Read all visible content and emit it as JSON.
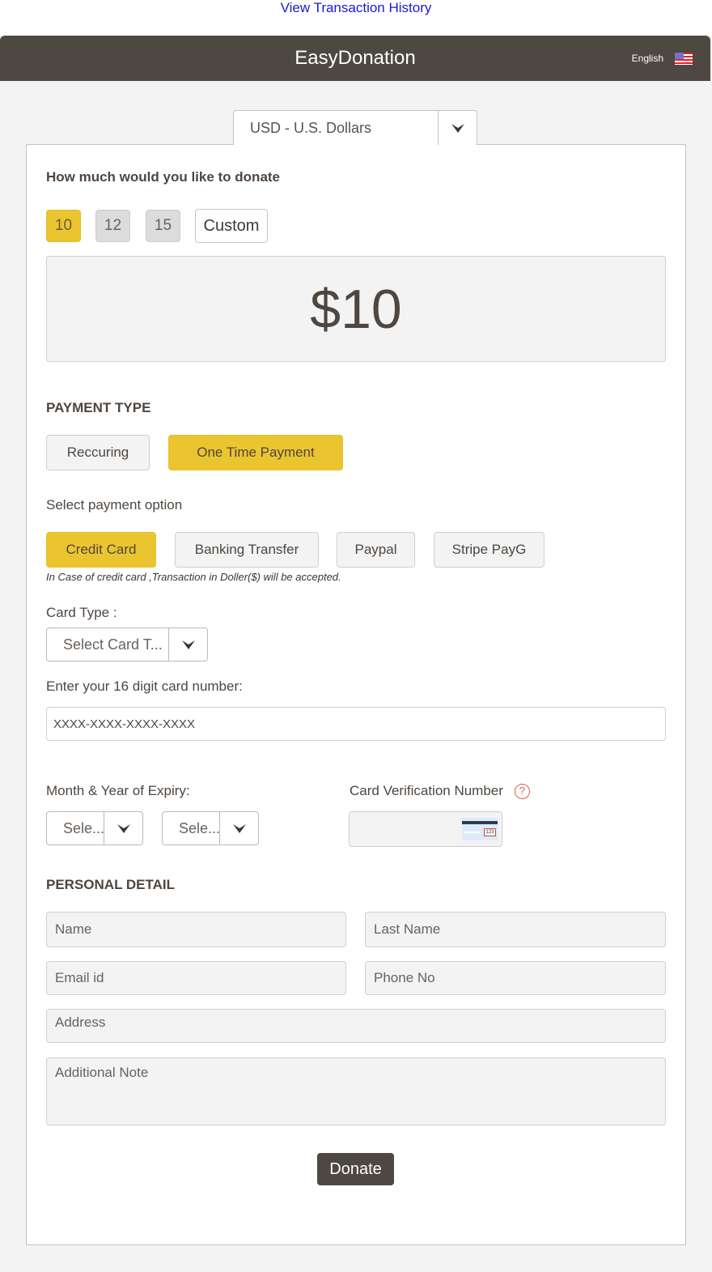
{
  "top_link": "View Transaction History",
  "header": {
    "title": "EasyDonation",
    "language": "English",
    "flag_icon": "us-flag-icon"
  },
  "currency": {
    "selected": "USD - U.S. Dollars"
  },
  "donation": {
    "question": "How much would you like to donate",
    "amounts": [
      {
        "label": "10",
        "selected": true
      },
      {
        "label": "12",
        "selected": false
      },
      {
        "label": "15",
        "selected": false
      },
      {
        "label": "Custom",
        "selected": false
      }
    ],
    "display_amount": "$10"
  },
  "payment_type": {
    "title": "PAYMENT TYPE",
    "options": [
      {
        "label": "Reccuring",
        "selected": false
      },
      {
        "label": "One Time Payment",
        "selected": true
      }
    ]
  },
  "payment_option": {
    "label": "Select payment option",
    "options": [
      {
        "label": "Credit Card",
        "selected": true
      },
      {
        "label": "Banking Transfer",
        "selected": false
      },
      {
        "label": "Paypal",
        "selected": false
      },
      {
        "label": "Stripe PayG",
        "selected": false
      }
    ],
    "note": "In Case of credit card ,Transaction in Doller($) will be accepted."
  },
  "card": {
    "type_label": "Card Type :",
    "type_selected": "Select Card T...",
    "number_label": "Enter your 16 digit card number:",
    "number_placeholder": "XXXX-XXXX-XXXX-XXXX",
    "expiry_label": "Month & Year of Expiry:",
    "month_selected": "Sele...",
    "year_selected": "Sele...",
    "cvv_label": "Card Verification Number",
    "cvv_value": "",
    "cvv_code_hint": "123"
  },
  "personal": {
    "title": "PERSONAL DETAIL",
    "name_placeholder": "Name",
    "last_name_placeholder": "Last Name",
    "email_placeholder": "Email id",
    "phone_placeholder": "Phone No",
    "address_placeholder": "Address",
    "note_placeholder": "Additional Note"
  },
  "donate_label": "Donate",
  "colors": {
    "accent": "#ebc52f",
    "header_bg": "#4e4843",
    "link": "#1a1ad6",
    "page_bg": "#f3f3f3"
  }
}
